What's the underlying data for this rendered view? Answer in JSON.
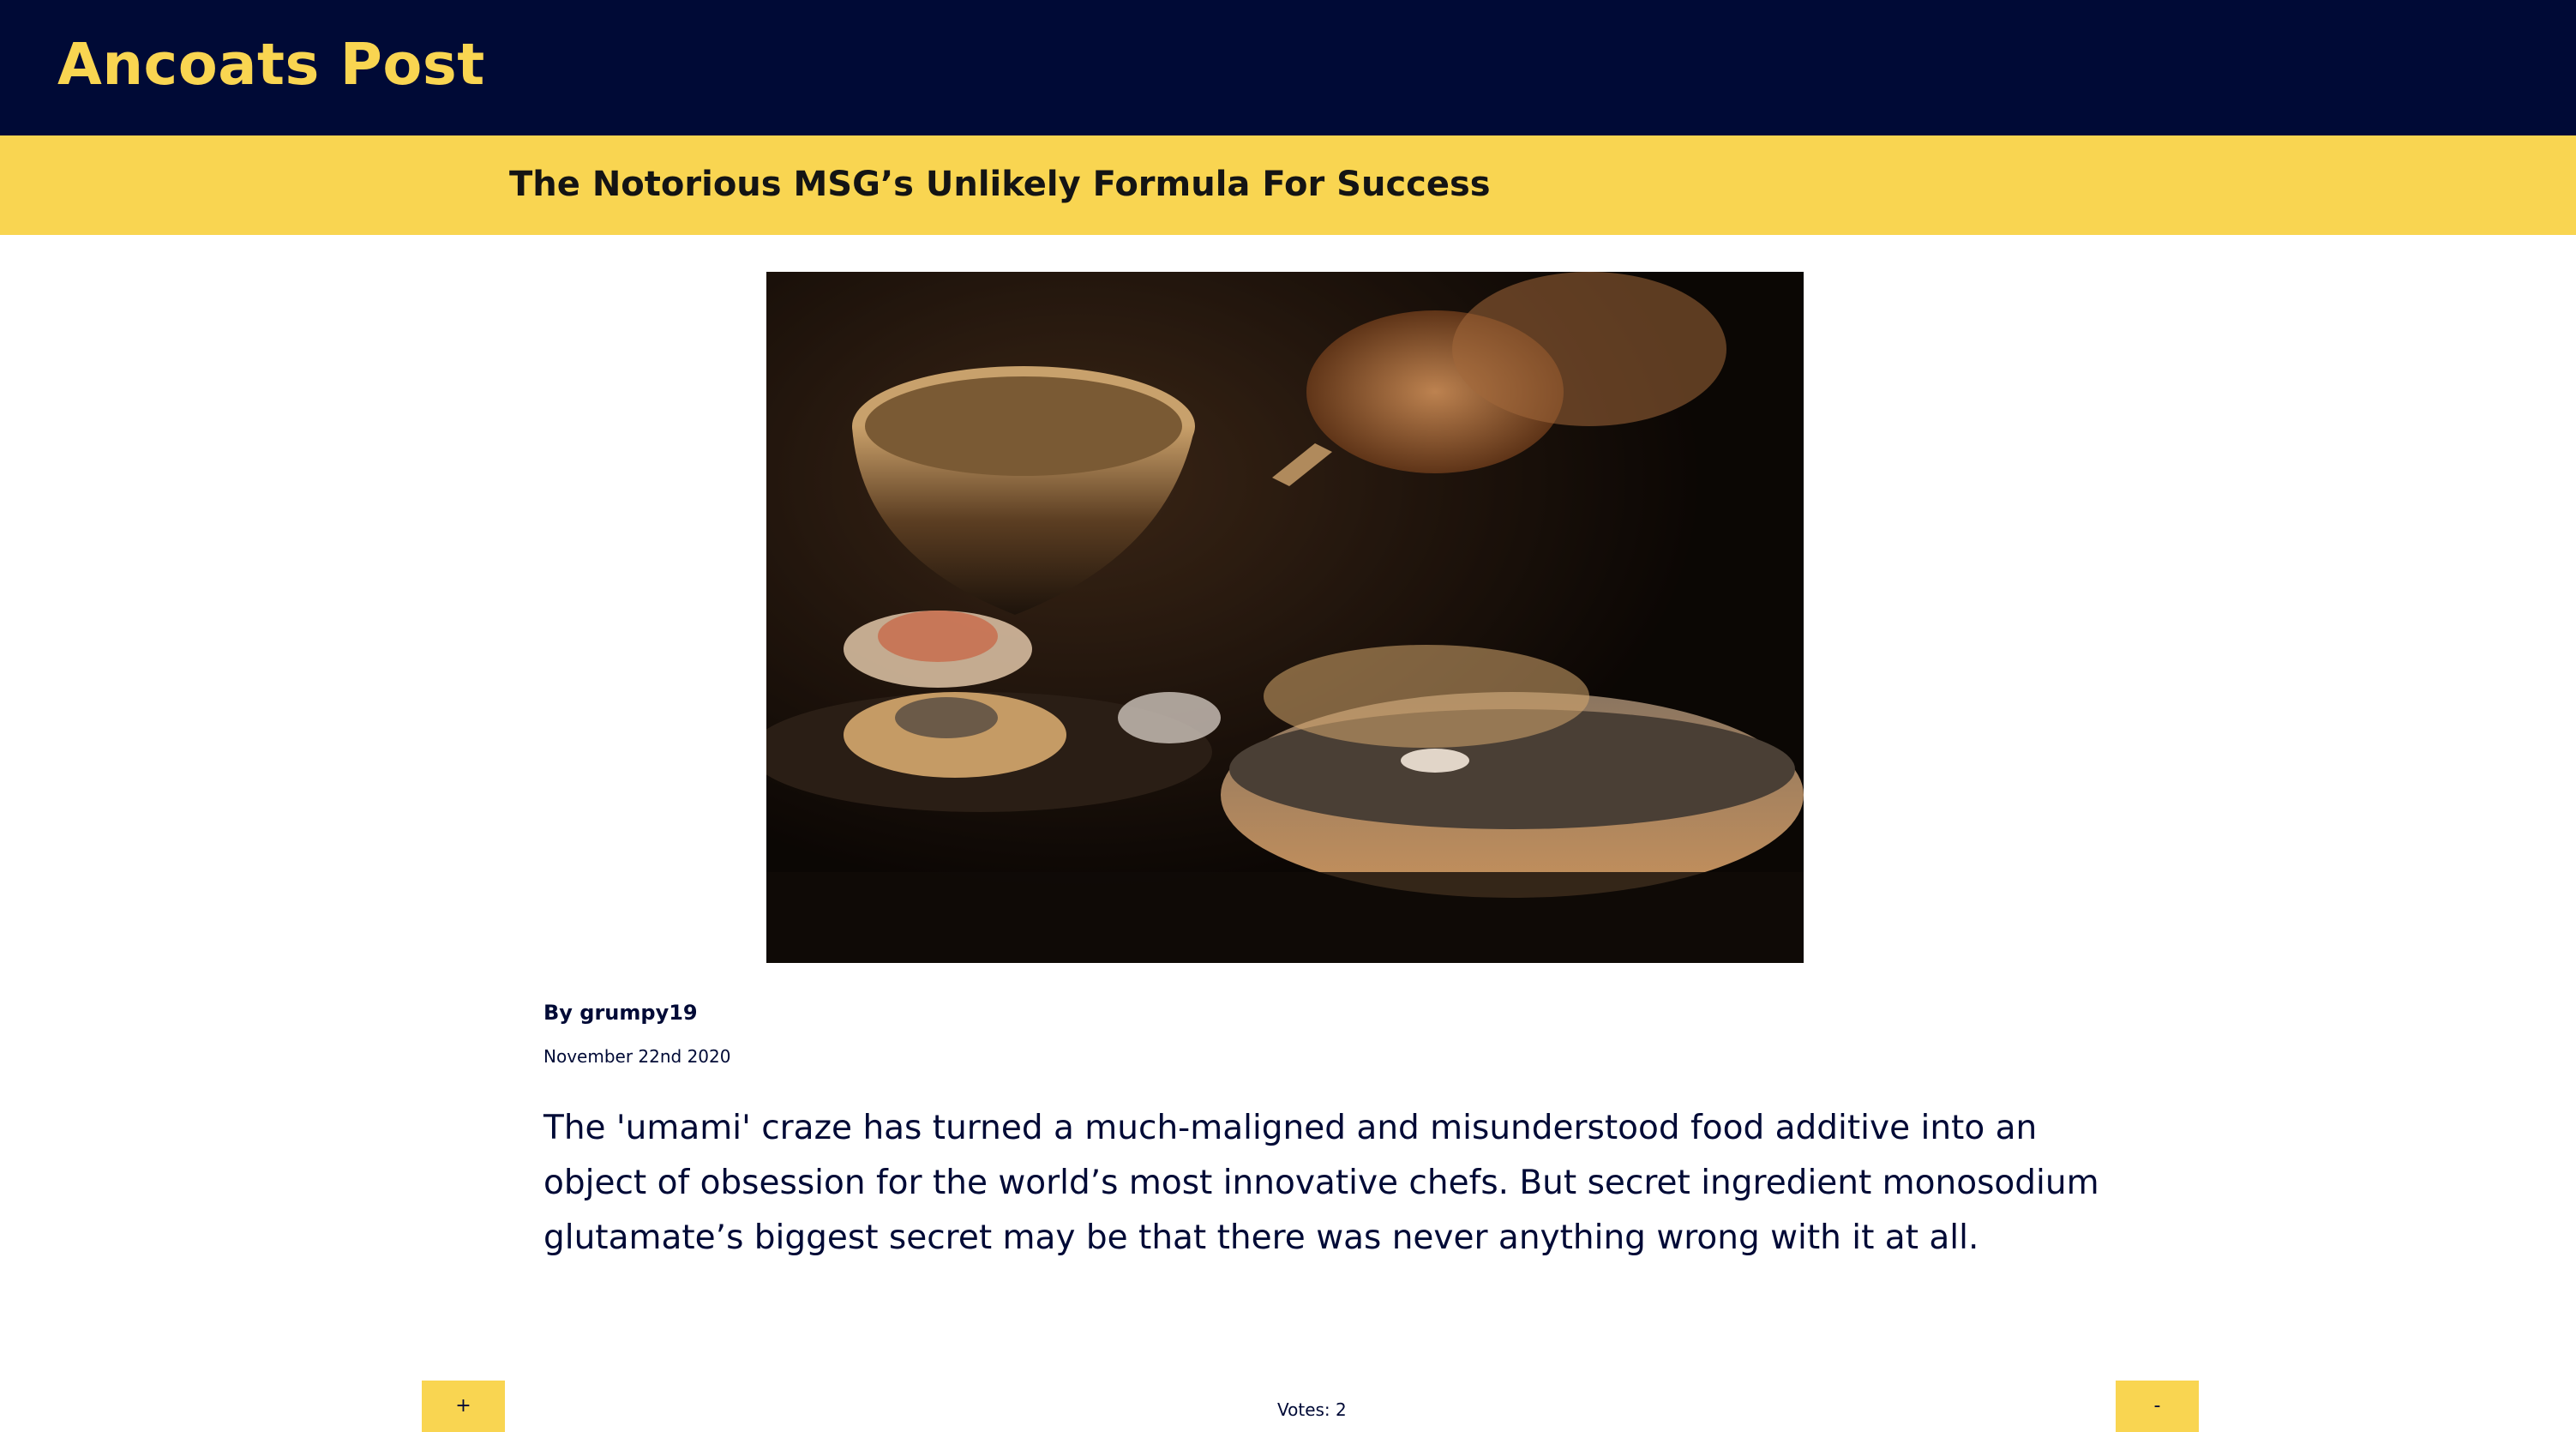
{
  "site": {
    "title": "Ancoats Post",
    "colors": {
      "header_bg": "#000a36",
      "accent": "#f9d551",
      "text": "#000a36"
    }
  },
  "article": {
    "headline": "The Notorious MSG’s Unlikely Formula For Success",
    "image_subject": "chef serving food from a pan in a dim kitchen",
    "byline": "By grumpy19",
    "date": "November 22nd 2020",
    "summary": "The 'umami' craze has turned a much-maligned and misunderstood food additive into an object of obsession for the world’s most innovative chefs. But secret ingredient monosodium glutamate’s biggest secret may be that there was never anything wrong with it at all."
  },
  "voting": {
    "upvote_label": "+",
    "downvote_label": "-",
    "votes_text": "Votes: 2"
  }
}
